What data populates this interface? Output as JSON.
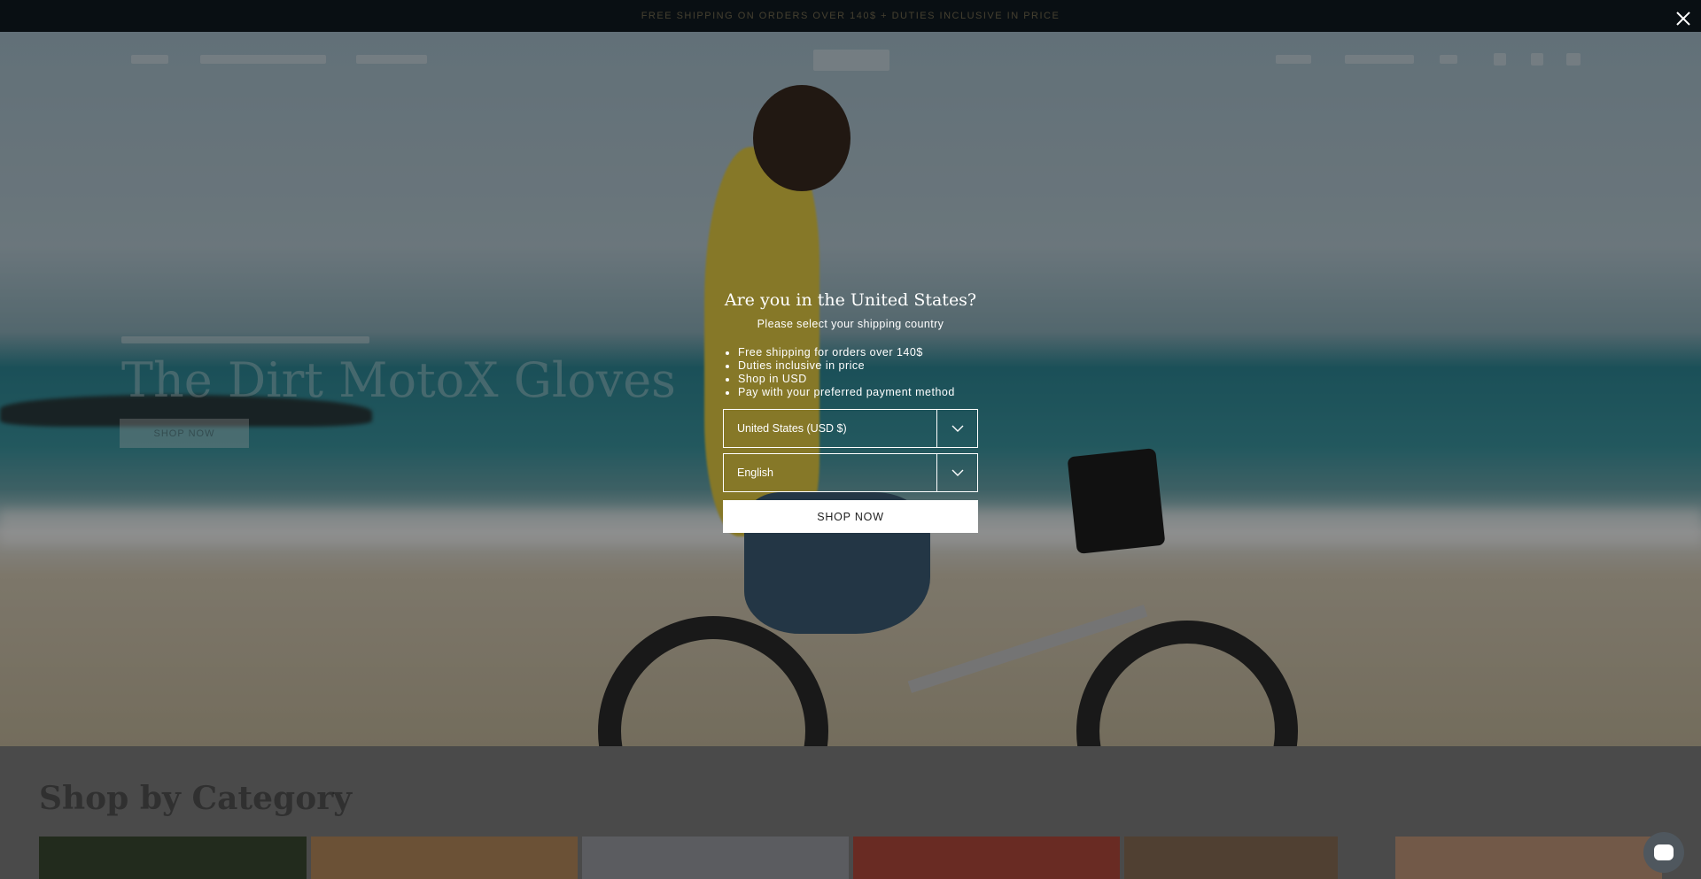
{
  "announcement": {
    "text": "FREE SHIPPING ON ORDERS OVER 140$ + DUTIES INCLUSIVE IN PRICE"
  },
  "hero": {
    "title": "The Dirt MotoX Gloves",
    "button_label": "SHOP NOW"
  },
  "category": {
    "heading": "Shop by Category"
  },
  "modal": {
    "title": "Are you in the United States?",
    "subtitle": "Please select your shipping country",
    "benefits": [
      "Free shipping for orders over 140$",
      "Duties inclusive in price",
      "Shop in USD",
      "Pay with your preferred payment method"
    ],
    "country_select": "United States (USD $)",
    "language_select": "English",
    "shop_button": "SHOP NOW",
    "close_icon": "close-icon"
  },
  "colors": {
    "announcement_bg": "#111a22",
    "modal_text": "#ffffff",
    "overlay": "rgba(0,0,0,0.42)"
  }
}
